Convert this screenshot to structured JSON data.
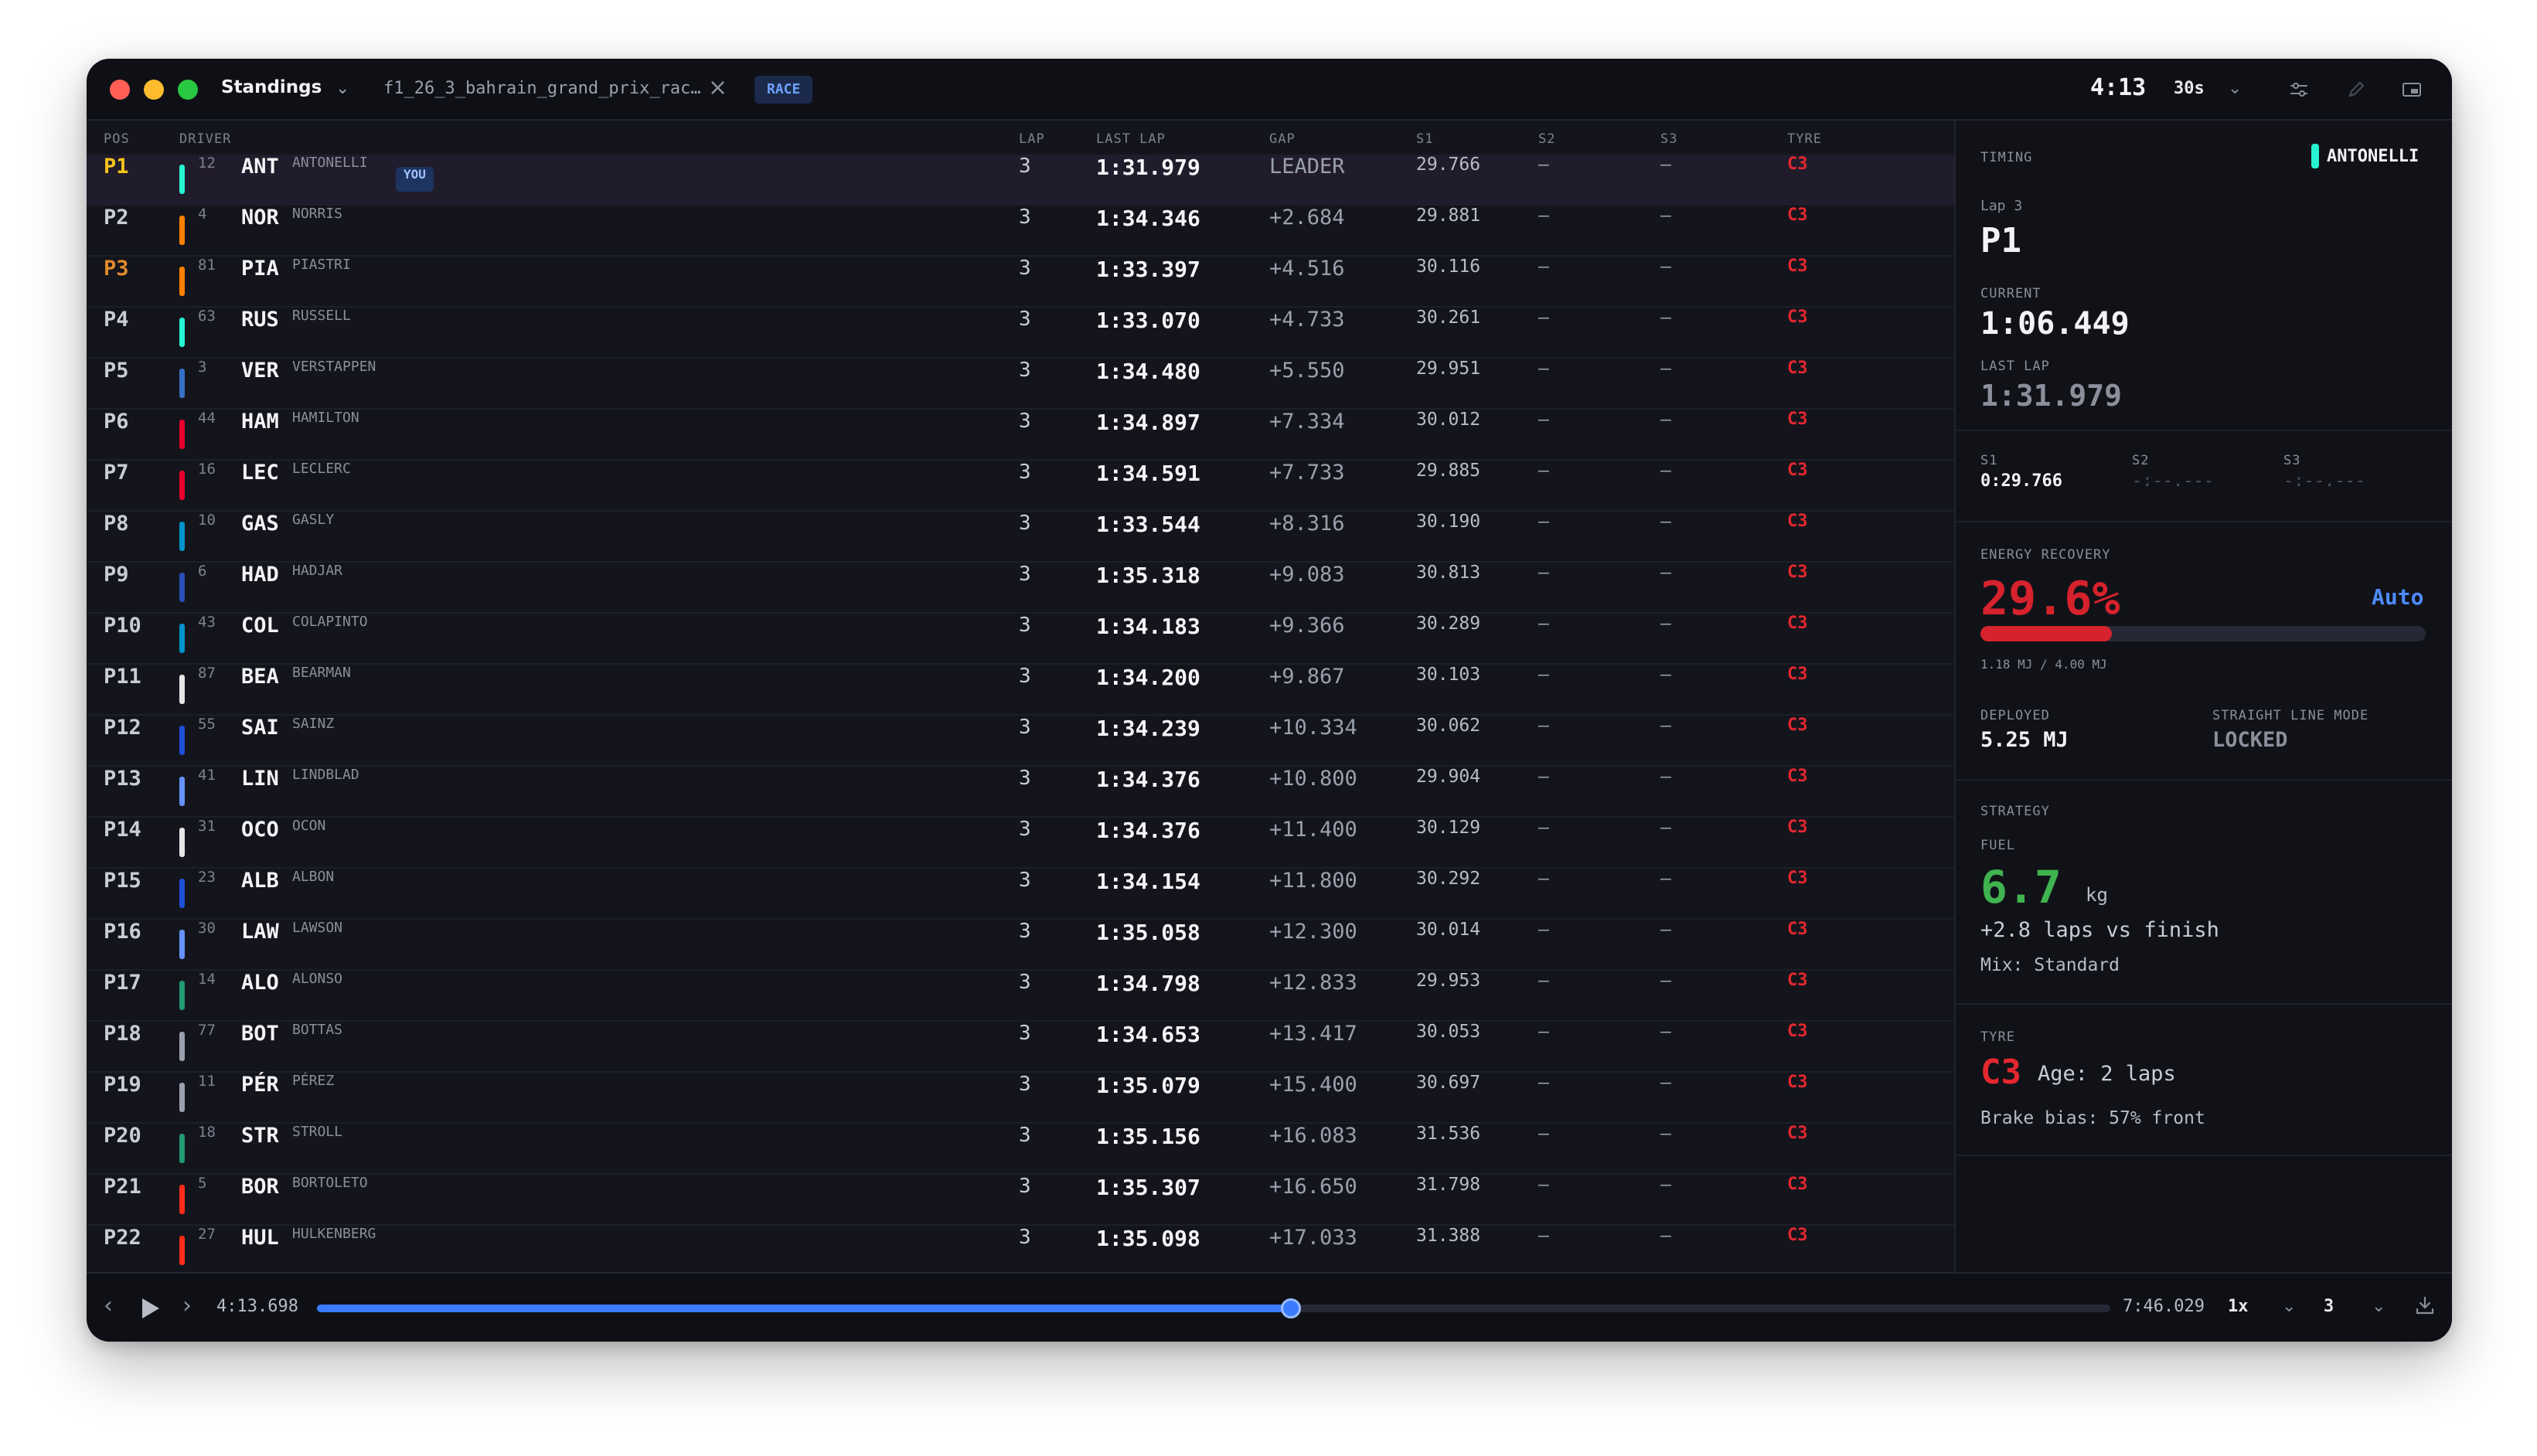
{
  "titlebar": {
    "view_label": "Standings",
    "file_tab": "f1_26_3_bahrain_grand_prix_rac…",
    "session_badge": "RACE",
    "session_time": "4:13",
    "interval": "30s"
  },
  "table": {
    "headers": {
      "pos": "POS",
      "driver": "DRIVER",
      "lap": "LAP",
      "last_lap": "LAST LAP",
      "gap": "GAP",
      "s1": "S1",
      "s2": "S2",
      "s3": "S3",
      "tyre": "TYRE"
    },
    "you_badge": "YOU",
    "rows": [
      {
        "pos": "P1",
        "num": "12",
        "code": "ANT",
        "name": "ANTONELLI",
        "team_color": "#27f4d2",
        "lap": "3",
        "last_lap": "1:31.979",
        "gap": "LEADER",
        "s1": "29.766",
        "s2": "—",
        "s3": "—",
        "tyre": "C3"
      },
      {
        "pos": "P2",
        "num": "4",
        "code": "NOR",
        "name": "NORRIS",
        "team_color": "#ff8000",
        "lap": "3",
        "last_lap": "1:34.346",
        "gap": "+2.684",
        "s1": "29.881",
        "s2": "—",
        "s3": "—",
        "tyre": "C3"
      },
      {
        "pos": "P3",
        "num": "81",
        "code": "PIA",
        "name": "PIASTRI",
        "team_color": "#ff8000",
        "lap": "3",
        "last_lap": "1:33.397",
        "gap": "+4.516",
        "s1": "30.116",
        "s2": "—",
        "s3": "—",
        "tyre": "C3"
      },
      {
        "pos": "P4",
        "num": "63",
        "code": "RUS",
        "name": "RUSSELL",
        "team_color": "#27f4d2",
        "lap": "3",
        "last_lap": "1:33.070",
        "gap": "+4.733",
        "s1": "30.261",
        "s2": "—",
        "s3": "—",
        "tyre": "C3"
      },
      {
        "pos": "P5",
        "num": "3",
        "code": "VER",
        "name": "VERSTAPPEN",
        "team_color": "#3671c6",
        "lap": "3",
        "last_lap": "1:34.480",
        "gap": "+5.550",
        "s1": "29.951",
        "s2": "—",
        "s3": "—",
        "tyre": "C3"
      },
      {
        "pos": "P6",
        "num": "44",
        "code": "HAM",
        "name": "HAMILTON",
        "team_color": "#e8002d",
        "lap": "3",
        "last_lap": "1:34.897",
        "gap": "+7.334",
        "s1": "30.012",
        "s2": "—",
        "s3": "—",
        "tyre": "C3"
      },
      {
        "pos": "P7",
        "num": "16",
        "code": "LEC",
        "name": "LECLERC",
        "team_color": "#e8002d",
        "lap": "3",
        "last_lap": "1:34.591",
        "gap": "+7.733",
        "s1": "29.885",
        "s2": "—",
        "s3": "—",
        "tyre": "C3"
      },
      {
        "pos": "P8",
        "num": "10",
        "code": "GAS",
        "name": "GASLY",
        "team_color": "#0093cc",
        "lap": "3",
        "last_lap": "1:33.544",
        "gap": "+8.316",
        "s1": "30.190",
        "s2": "—",
        "s3": "—",
        "tyre": "C3"
      },
      {
        "pos": "P9",
        "num": "6",
        "code": "HAD",
        "name": "HADJAR",
        "team_color": "#2b4fb8",
        "lap": "3",
        "last_lap": "1:35.318",
        "gap": "+9.083",
        "s1": "30.813",
        "s2": "—",
        "s3": "—",
        "tyre": "C3"
      },
      {
        "pos": "P10",
        "num": "43",
        "code": "COL",
        "name": "COLAPINTO",
        "team_color": "#0093cc",
        "lap": "3",
        "last_lap": "1:34.183",
        "gap": "+9.366",
        "s1": "30.289",
        "s2": "—",
        "s3": "—",
        "tyre": "C3"
      },
      {
        "pos": "P11",
        "num": "87",
        "code": "BEA",
        "name": "BEARMAN",
        "team_color": "#e6e6e6",
        "lap": "3",
        "last_lap": "1:34.200",
        "gap": "+9.867",
        "s1": "30.103",
        "s2": "—",
        "s3": "—",
        "tyre": "C3"
      },
      {
        "pos": "P12",
        "num": "55",
        "code": "SAI",
        "name": "SAINZ",
        "team_color": "#1e4fd8",
        "lap": "3",
        "last_lap": "1:34.239",
        "gap": "+10.334",
        "s1": "30.062",
        "s2": "—",
        "s3": "—",
        "tyre": "C3"
      },
      {
        "pos": "P13",
        "num": "41",
        "code": "LIN",
        "name": "LINDBLAD",
        "team_color": "#6692ff",
        "lap": "3",
        "last_lap": "1:34.376",
        "gap": "+10.800",
        "s1": "29.904",
        "s2": "—",
        "s3": "—",
        "tyre": "C3"
      },
      {
        "pos": "P14",
        "num": "31",
        "code": "OCO",
        "name": "OCON",
        "team_color": "#e6e6e6",
        "lap": "3",
        "last_lap": "1:34.376",
        "gap": "+11.400",
        "s1": "30.129",
        "s2": "—",
        "s3": "—",
        "tyre": "C3"
      },
      {
        "pos": "P15",
        "num": "23",
        "code": "ALB",
        "name": "ALBON",
        "team_color": "#1e4fd8",
        "lap": "3",
        "last_lap": "1:34.154",
        "gap": "+11.800",
        "s1": "30.292",
        "s2": "—",
        "s3": "—",
        "tyre": "C3"
      },
      {
        "pos": "P16",
        "num": "30",
        "code": "LAW",
        "name": "LAWSON",
        "team_color": "#6692ff",
        "lap": "3",
        "last_lap": "1:35.058",
        "gap": "+12.300",
        "s1": "30.014",
        "s2": "—",
        "s3": "—",
        "tyre": "C3"
      },
      {
        "pos": "P17",
        "num": "14",
        "code": "ALO",
        "name": "ALONSO",
        "team_color": "#229971",
        "lap": "3",
        "last_lap": "1:34.798",
        "gap": "+12.833",
        "s1": "29.953",
        "s2": "—",
        "s3": "—",
        "tyre": "C3"
      },
      {
        "pos": "P18",
        "num": "77",
        "code": "BOT",
        "name": "BOTTAS",
        "team_color": "#9aa0ad",
        "lap": "3",
        "last_lap": "1:34.653",
        "gap": "+13.417",
        "s1": "30.053",
        "s2": "—",
        "s3": "—",
        "tyre": "C3"
      },
      {
        "pos": "P19",
        "num": "11",
        "code": "PÉR",
        "name": "PÉREZ",
        "team_color": "#9aa0ad",
        "lap": "3",
        "last_lap": "1:35.079",
        "gap": "+15.400",
        "s1": "30.697",
        "s2": "—",
        "s3": "—",
        "tyre": "C3"
      },
      {
        "pos": "P20",
        "num": "18",
        "code": "STR",
        "name": "STROLL",
        "team_color": "#229971",
        "lap": "3",
        "last_lap": "1:35.156",
        "gap": "+16.083",
        "s1": "31.536",
        "s2": "—",
        "s3": "—",
        "tyre": "C3"
      },
      {
        "pos": "P21",
        "num": "5",
        "code": "BOR",
        "name": "BORTOLETO",
        "team_color": "#ff2d1a",
        "lap": "3",
        "last_lap": "1:35.307",
        "gap": "+16.650",
        "s1": "31.798",
        "s2": "—",
        "s3": "—",
        "tyre": "C3"
      },
      {
        "pos": "P22",
        "num": "27",
        "code": "HUL",
        "name": "HULKENBERG",
        "team_color": "#ff2d1a",
        "lap": "3",
        "last_lap": "1:35.098",
        "gap": "+17.033",
        "s1": "31.388",
        "s2": "—",
        "s3": "—",
        "tyre": "C3"
      }
    ]
  },
  "panel": {
    "timing": {
      "label": "TIMING",
      "driver": "ANTONELLI",
      "driver_color": "#27f4d2",
      "lap_label": "Lap 3",
      "position": "P1",
      "current_label": "CURRENT",
      "current_time": "1:06.449",
      "last_lap_label": "LAST LAP",
      "last_lap_time": "1:31.979"
    },
    "sectors": {
      "s1_label": "S1",
      "s1_value": "0:29.766",
      "s2_label": "S2",
      "s2_value": "-:--.---",
      "s3_label": "S3",
      "s3_value": "-:--.---"
    },
    "energy": {
      "label": "ENERGY RECOVERY",
      "percent_text": "29.6%",
      "fraction": 0.296,
      "mode": "Auto",
      "detail": "1.18 MJ / 4.00 MJ",
      "deployed_label": "DEPLOYED",
      "deployed_value": "5.25 MJ",
      "slm_label": "STRAIGHT LINE MODE",
      "slm_value": "LOCKED"
    },
    "strategy": {
      "label": "STRATEGY",
      "fuel_label": "FUEL",
      "fuel_value": "6.7",
      "fuel_unit": "kg",
      "fuel_delta": "+2.8 laps vs finish",
      "mix": "Mix: Standard"
    },
    "tyre": {
      "label": "TYRE",
      "compound": "C3",
      "age": "Age: 2 laps",
      "brake_bias": "Brake bias: 57% front"
    }
  },
  "playback": {
    "current_time": "4:13.698",
    "total_time": "7:46.029",
    "progress": 0.543,
    "speed": "1x",
    "lap": "3"
  },
  "colors": {
    "accent": "#3b7bff",
    "tyre_red": "#e5272f",
    "energy_red": "#d6222c",
    "fuel_green": "#3fb34f"
  }
}
